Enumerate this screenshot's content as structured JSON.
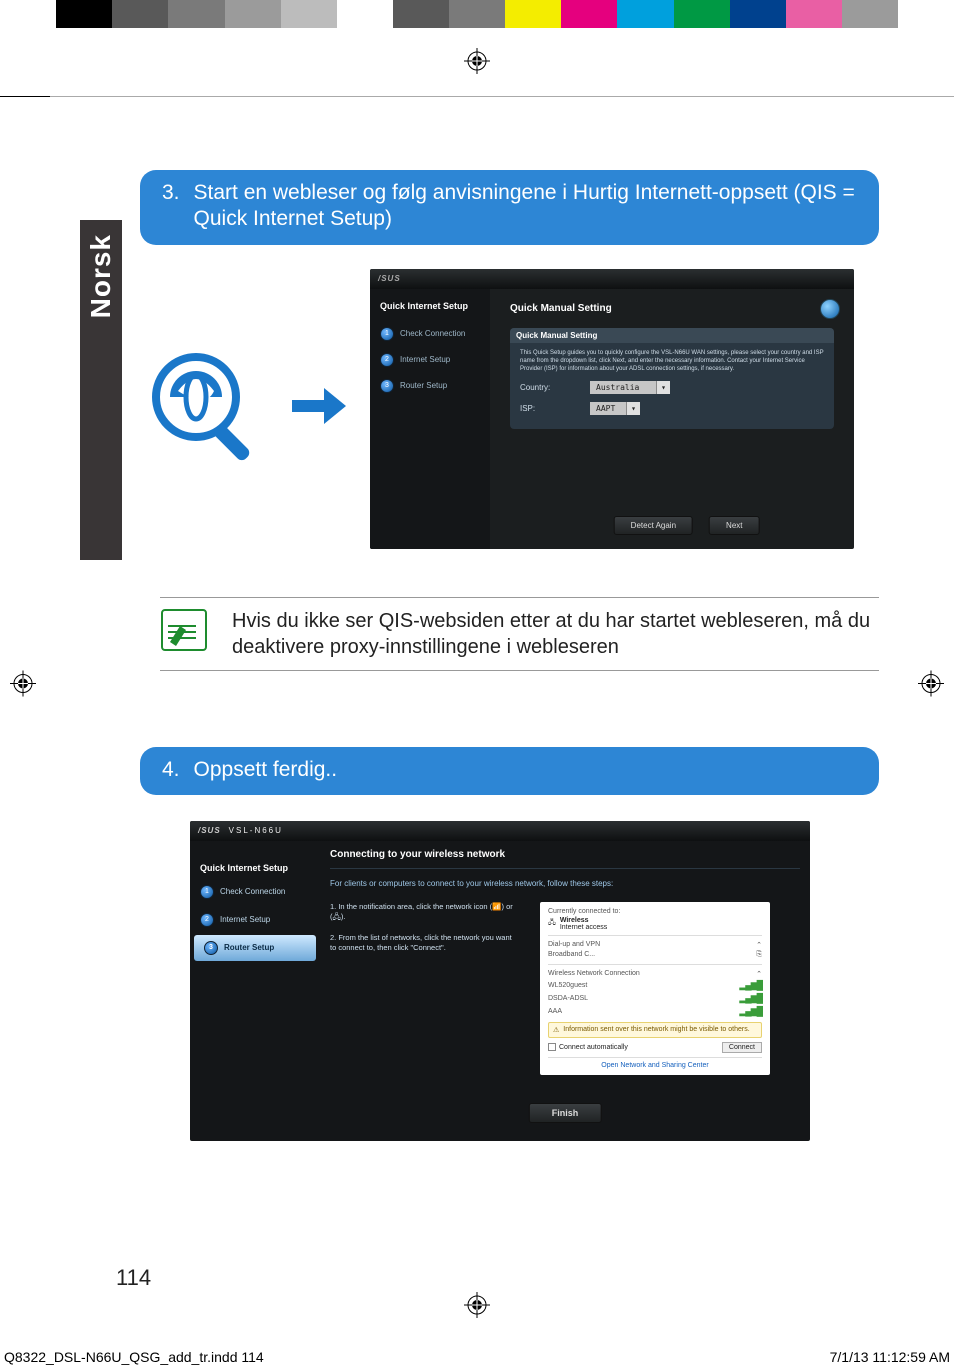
{
  "color_bar": [
    "#ffffff",
    "#000000",
    "#595959",
    "#7a7a7a",
    "#9b9b9b",
    "#bcbcbc",
    "#ffffff",
    "#595959",
    "#7a7a7a",
    "#f4ed00",
    "#e5007e",
    "#00a0dd",
    "#009944",
    "#00418e",
    "#e95fa4",
    "#9b9b9b",
    "#ffffff"
  ],
  "language_tab": "Norsk",
  "step3": {
    "num": "3.",
    "text": "Start en webleser og følg anvisningene i Hurtig Internett-oppsett (QIS = Quick Internet Setup)"
  },
  "shot1": {
    "brand": "/SUS",
    "sidebar_title": "Quick Internet Setup",
    "sidebar_items": [
      {
        "n": "1",
        "label": "Check Connection"
      },
      {
        "n": "2",
        "label": "Internet Setup"
      },
      {
        "n": "3",
        "label": "Router Setup"
      }
    ],
    "main_title": "Quick Manual Setting",
    "panel_title": "Quick Manual Setting",
    "panel_desc": "This Quick Setup guides you to quickly configure the VSL-N66U WAN settings, please select your country and ISP name from the dropdown list, click Next, and enter the necessary information. Contact your Internet Service Provider (ISP) for information about your ADSL connection settings, if necessary.",
    "row_country_label": "Country:",
    "row_country_value": "Australia",
    "row_isp_label": "ISP:",
    "row_isp_value": "AAPT",
    "btn_detect": "Detect Again",
    "btn_next": "Next"
  },
  "note_text": "Hvis du ikke ser QIS-websiden etter at du har startet webleseren, må du deaktivere proxy-innstillingene i webleseren",
  "step4": {
    "num": "4.",
    "text": "Oppsett ferdig.."
  },
  "shot2": {
    "brand": "/SUS",
    "model": "VSL-N66U",
    "sidebar_title": "Quick Internet Setup",
    "sidebar_items": [
      {
        "n": "1",
        "label": "Check Connection",
        "active": false
      },
      {
        "n": "2",
        "label": "Internet Setup",
        "active": false
      },
      {
        "n": "3",
        "label": "Router Setup",
        "active": true
      }
    ],
    "conn_title": "Connecting to your wireless network",
    "sub": "For clients or computers to connect to your wireless network, follow these steps:",
    "instr1": "1. In the notification area, click the network icon (📶) or (🖧).",
    "instr2": "2. From the list of networks, click the network you want to connect to, then click \"Connect\".",
    "win_head1": "Currently connected to:",
    "win_head2": "Wireless",
    "win_head3": "Internet access",
    "win_dial": "Dial-up and VPN",
    "win_broad": "Broadband C...",
    "win_wconn": "Wireless Network Connection",
    "win_nets": [
      "WL520guest",
      "DSDA-ADSL",
      "AAA"
    ],
    "win_warn": "Information sent over this network might be visible to others.",
    "win_auto": "Connect automatically",
    "win_connect": "Connect",
    "win_open": "Open Network and Sharing Center",
    "finish": "Finish"
  },
  "page_number": "114",
  "footer_file": "Q8322_DSL-N66U_QSG_add_tr.indd   114",
  "footer_date": "7/1/13   11:12:59 AM"
}
